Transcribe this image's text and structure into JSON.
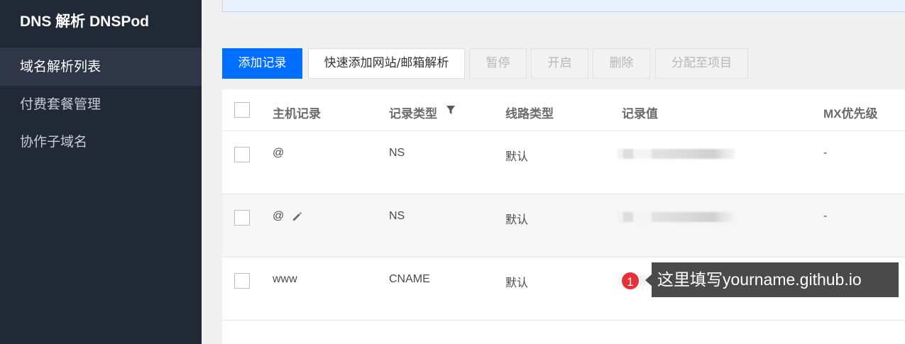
{
  "app": {
    "title": "DNS 解析 DNSPod"
  },
  "sidebar": {
    "items": [
      {
        "label": "域名解析列表",
        "active": true
      },
      {
        "label": "付费套餐管理",
        "active": false
      },
      {
        "label": "协作子域名",
        "active": false
      }
    ]
  },
  "toolbar": {
    "add_record": "添加记录",
    "quick_add": "快速添加网站/邮箱解析",
    "pause": "暂停",
    "enable": "开启",
    "delete": "删除",
    "assign_project": "分配至项目"
  },
  "table": {
    "headers": {
      "host": "主机记录",
      "type": "记录类型",
      "line": "线路类型",
      "value": "记录值",
      "mx": "MX优先级"
    },
    "rows": [
      {
        "host": "@",
        "type": "NS",
        "line": "默认",
        "mx": "-"
      },
      {
        "host": "@",
        "type": "NS",
        "line": "默认",
        "mx": "-"
      },
      {
        "host": "www",
        "type": "CNAME",
        "line": "默认",
        "mx": ""
      }
    ]
  },
  "tooltip": {
    "step": "1",
    "text": "这里填写yourname.github.io"
  },
  "colors": {
    "sidebar_bg": "#212836",
    "primary": "#006eff",
    "badge": "#e8303a",
    "tooltip_bg": "#4a4a4a"
  },
  "icons": {
    "filter": "filter-icon",
    "edit": "pencil-icon"
  }
}
